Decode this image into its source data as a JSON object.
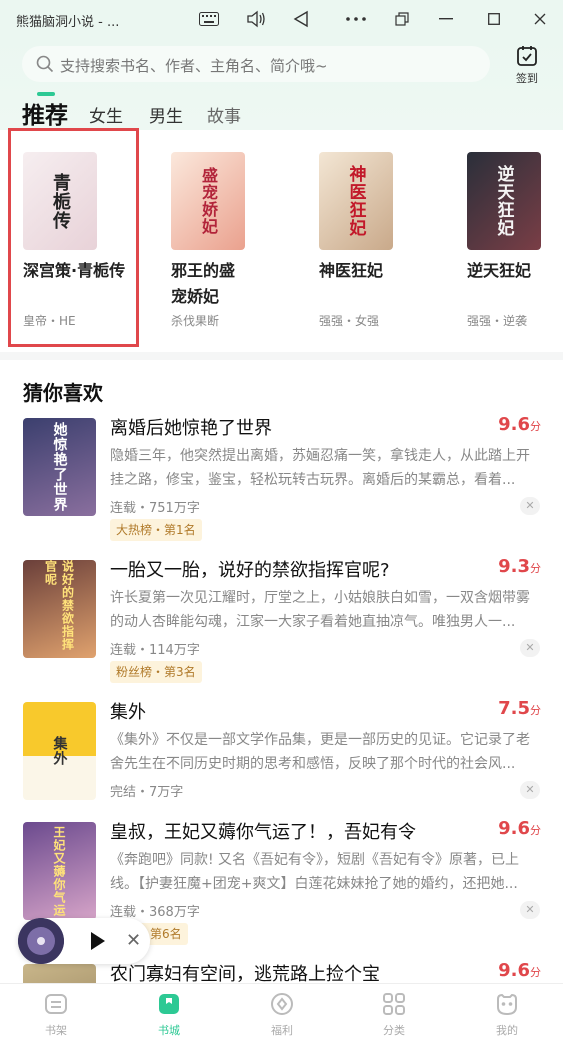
{
  "window": {
    "title": "熊猫脑洞小说 - ..."
  },
  "header": {
    "search_placeholder": "支持搜索书名、作者、主角名、简介哦~",
    "checkin_label": "签到",
    "tabs": [
      "推荐",
      "女生",
      "男生",
      "故事"
    ]
  },
  "recommend": [
    {
      "title": "深宫策·青栀传",
      "meta": "皇帝・HE",
      "cover_text": "青栀传"
    },
    {
      "title": "邪王的盛宠娇妃",
      "meta": "杀伐果断",
      "cover_text": "盛宠娇妃"
    },
    {
      "title": "神医狂妃",
      "meta": "强强・女强",
      "cover_text": "神医狂妃"
    },
    {
      "title": "逆天狂妃",
      "meta": "强强・逆袭",
      "cover_text": "逆天狂妃"
    }
  ],
  "guess": {
    "title": "猜你喜欢",
    "items": [
      {
        "title": "离婚后她惊艳了世界",
        "score": "9.6",
        "score_unit": "分",
        "desc": "隐婚三年，他突然提出离婚，苏婳忍痛一笑，拿钱走人，从此踏上开挂之路，修宝，鉴宝，轻松玩转古玩界。离婚后的某霸总，看着...",
        "meta": "连载・751万字",
        "rank": "大热榜・第1名",
        "cover_text": "她惊艳了世界"
      },
      {
        "title": "一胎又一胎，说好的禁欲指挥官呢?",
        "score": "9.3",
        "score_unit": "分",
        "desc": "许长夏第一次见江耀时，厅堂之上，小姑娘肤白如雪，一双含烟带雾的动人杏眸能勾魂，江家一大家子看着她直抽凉气。唯独男人一...",
        "meta": "连载・114万字",
        "rank": "粉丝榜・第3名",
        "cover_text": "说好的禁欲指挥官呢"
      },
      {
        "title": "集外",
        "score": "7.5",
        "score_unit": "分",
        "desc": "《集外》不仅是一部文学作品集，更是一部历史的见证。它记录了老舍先生在不同历史时期的思考和感悟，反映了那个时代的社会风...",
        "meta": "完结・7万字",
        "rank": "",
        "cover_text": "集外"
      },
      {
        "title": "皇叔，王妃又薅你气运了！，吾妃有令",
        "score": "9.6",
        "score_unit": "分",
        "desc": "《奔跑吧》同款! 又名《吾妃有令》，短剧《吾妃有令》原著，已上线。【护妻狂魔+团宠+爽文】白莲花妹妹抢了她的婚约，还把她...",
        "meta": "连载・368万字",
        "rank": "类・第6名",
        "cover_text": "王妃又薅你气运"
      },
      {
        "title": "农门寡妇有空间，逃荒路上捡个宝",
        "score": "9.6",
        "score_unit": "分",
        "desc": "",
        "meta": "",
        "rank": "",
        "cover_text": ""
      }
    ]
  },
  "nav": [
    {
      "label": "书架",
      "icon": "bookshelf-icon"
    },
    {
      "label": "书城",
      "icon": "bookstore-icon"
    },
    {
      "label": "福利",
      "icon": "welfare-icon"
    },
    {
      "label": "分类",
      "icon": "category-icon"
    },
    {
      "label": "我的",
      "icon": "profile-icon"
    }
  ],
  "colors": {
    "accent": "#2dc994",
    "score": "#e0474b",
    "highlight": "#e0474b"
  }
}
